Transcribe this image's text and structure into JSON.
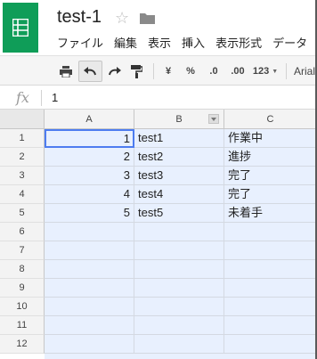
{
  "document": {
    "title": "test-1"
  },
  "menu": [
    "ファイル",
    "編集",
    "表示",
    "挿入",
    "表示形式",
    "データ"
  ],
  "toolbar": {
    "currency": "¥",
    "percent": "%",
    "decrease_decimal": ".0",
    "increase_decimal": ".00",
    "more_formats": "123",
    "font": "Arial"
  },
  "formula_bar": {
    "fx_label": "fx",
    "value": "1"
  },
  "columns": [
    "A",
    "B",
    "C"
  ],
  "rows": [
    {
      "num": "1",
      "a": "1",
      "b": "test1",
      "c": "作業中"
    },
    {
      "num": "2",
      "a": "2",
      "b": "test2",
      "c": "進捗"
    },
    {
      "num": "3",
      "a": "3",
      "b": "test3",
      "c": "完了"
    },
    {
      "num": "4",
      "a": "4",
      "b": "test4",
      "c": "完了"
    },
    {
      "num": "5",
      "a": "5",
      "b": "test5",
      "c": "未着手"
    },
    {
      "num": "6",
      "a": "",
      "b": "",
      "c": ""
    },
    {
      "num": "7",
      "a": "",
      "b": "",
      "c": ""
    },
    {
      "num": "8",
      "a": "",
      "b": "",
      "c": ""
    },
    {
      "num": "9",
      "a": "",
      "b": "",
      "c": ""
    },
    {
      "num": "10",
      "a": "",
      "b": "",
      "c": ""
    },
    {
      "num": "11",
      "a": "",
      "b": "",
      "c": ""
    },
    {
      "num": "12",
      "a": "",
      "b": "",
      "c": ""
    }
  ],
  "colors": {
    "brand": "#0f9d58",
    "selection": "#e8f0fe",
    "active_border": "#4d7cf0"
  },
  "icons": [
    "sheets-logo-icon",
    "star-icon",
    "folder-icon",
    "print-icon",
    "undo-icon",
    "redo-icon",
    "paint-format-icon",
    "filter-icon"
  ]
}
